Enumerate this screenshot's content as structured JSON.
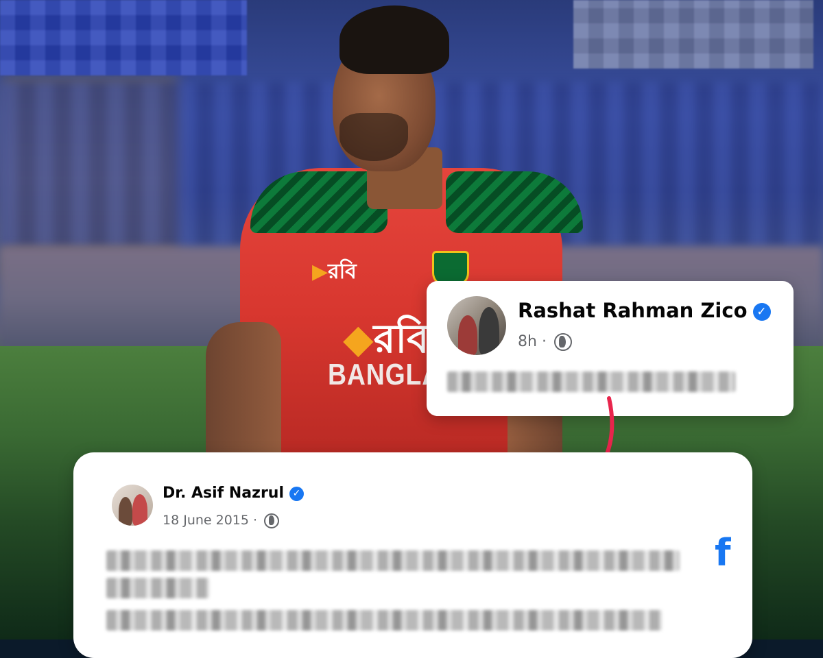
{
  "top_post": {
    "author": "Rashat Rahman Zico",
    "verified_mark": "✓",
    "time": "8h",
    "separator": "·",
    "audience_icon": "globe-icon"
  },
  "bottom_post": {
    "author": "Dr. Asif Nazrul",
    "verified_mark": "✓",
    "date": "18 June 2015",
    "separator": "·",
    "audience_icon": "globe-icon",
    "platform_icon": "facebook-icon",
    "platform_glyph": "f"
  },
  "jersey": {
    "sponsor": "রবি",
    "country_text": "BANGLADE"
  },
  "colors": {
    "verified_blue": "#1877f2",
    "arrow_red": "#e8254c",
    "meta_gray": "#65676b"
  }
}
